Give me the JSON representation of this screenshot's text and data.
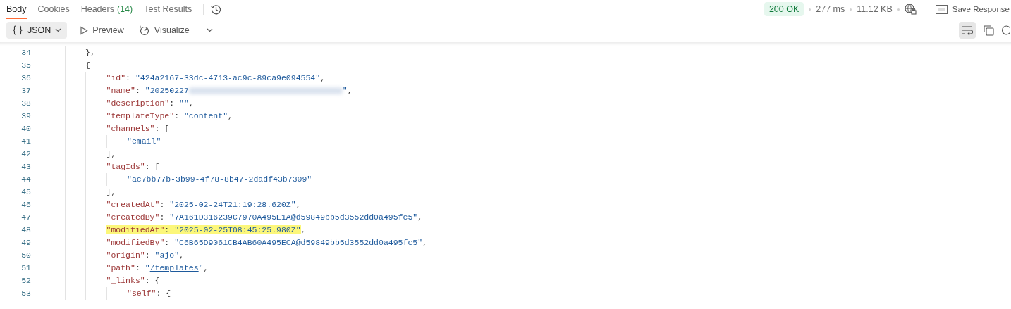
{
  "tabs": [
    {
      "label": "Body",
      "selected": true
    },
    {
      "label": "Cookies",
      "selected": false
    },
    {
      "label": "Headers",
      "count": "(14)",
      "selected": false
    },
    {
      "label": "Test Results",
      "selected": false
    }
  ],
  "status": {
    "code": "200 OK",
    "time": "277 ms",
    "size": "11.12 KB",
    "save": "Save Response"
  },
  "format": {
    "label": "JSON"
  },
  "views": [
    {
      "kind": "preview",
      "label": "Preview"
    },
    {
      "kind": "visualize",
      "label": "Visualize"
    }
  ],
  "wrap": {
    "selected": true
  },
  "code": [
    {
      "number": "34",
      "highlighted": false,
      "tokens": [
        {
          "kind": "punct",
          "text": "},"
        }
      ]
    },
    {
      "number": "35",
      "highlighted": false,
      "tokens": [
        {
          "kind": "punct",
          "text": "{"
        }
      ],
      "children": [
        {
          "number": "36",
          "highlighted": false,
          "tokens": [
            {
              "kind": "key",
              "text": "\"id\""
            },
            {
              "kind": "punct",
              "text": ": "
            },
            {
              "kind": "string",
              "text": "\"424a2167-33dc-4713-ac9c-89ca9e094554\""
            },
            {
              "kind": "punct",
              "text": ","
            }
          ]
        },
        {
          "number": "37",
          "highlighted": false,
          "tokens": [
            {
              "kind": "key",
              "text": "\"name\""
            },
            {
              "kind": "punct",
              "text": ": "
            },
            {
              "kind": "string",
              "text": "\"20250227"
            },
            {
              "kind": "redacted"
            },
            {
              "kind": "string",
              "text": "\""
            },
            {
              "kind": "punct",
              "text": ","
            }
          ]
        },
        {
          "number": "38",
          "highlighted": false,
          "tokens": [
            {
              "kind": "key",
              "text": "\"description\""
            },
            {
              "kind": "punct",
              "text": ": "
            },
            {
              "kind": "string",
              "text": "\"\""
            },
            {
              "kind": "punct",
              "text": ","
            }
          ]
        },
        {
          "number": "39",
          "highlighted": false,
          "tokens": [
            {
              "kind": "key",
              "text": "\"templateType\""
            },
            {
              "kind": "punct",
              "text": ": "
            },
            {
              "kind": "string",
              "text": "\"content\""
            },
            {
              "kind": "punct",
              "text": ","
            }
          ]
        },
        {
          "number": "40",
          "highlighted": false,
          "tokens": [
            {
              "kind": "key",
              "text": "\"channels\""
            },
            {
              "kind": "punct",
              "text": ": ["
            }
          ],
          "children": [
            {
              "number": "41",
              "highlighted": false,
              "tokens": [
                {
                  "kind": "string",
                  "text": "\"email\""
                }
              ]
            }
          ]
        },
        {
          "number": "42",
          "highlighted": false,
          "tokens": [
            {
              "kind": "punct",
              "text": "],"
            }
          ]
        },
        {
          "number": "43",
          "highlighted": false,
          "tokens": [
            {
              "kind": "key",
              "text": "\"tagIds\""
            },
            {
              "kind": "punct",
              "text": ": ["
            }
          ],
          "children": [
            {
              "number": "44",
              "highlighted": false,
              "tokens": [
                {
                  "kind": "string",
                  "text": "\"ac7bb77b-3b99-4f78-8b47-2dadf43b7309\""
                }
              ]
            }
          ]
        },
        {
          "number": "45",
          "highlighted": false,
          "tokens": [
            {
              "kind": "punct",
              "text": "],"
            }
          ]
        },
        {
          "number": "46",
          "highlighted": false,
          "tokens": [
            {
              "kind": "key",
              "text": "\"createdAt\""
            },
            {
              "kind": "punct",
              "text": ": "
            },
            {
              "kind": "string",
              "text": "\"2025-02-24T21:19:28.620Z\""
            },
            {
              "kind": "punct",
              "text": ","
            }
          ]
        },
        {
          "number": "47",
          "highlighted": false,
          "tokens": [
            {
              "kind": "key",
              "text": "\"createdBy\""
            },
            {
              "kind": "punct",
              "text": ": "
            },
            {
              "kind": "string",
              "text": "\"7A161D316239C7970A495E1A@d59849bb5d3552dd0a495fc5\""
            },
            {
              "kind": "punct",
              "text": ","
            }
          ]
        },
        {
          "number": "48",
          "highlighted": true,
          "tokens": [
            {
              "kind": "key",
              "text": "\"modifiedAt\""
            },
            {
              "kind": "punct",
              "text": ": "
            },
            {
              "kind": "string",
              "text": "\"2025-02-25T08:45:25.980Z\""
            },
            {
              "kind": "punct",
              "text": ","
            }
          ]
        },
        {
          "number": "49",
          "highlighted": false,
          "tokens": [
            {
              "kind": "key",
              "text": "\"modifiedBy\""
            },
            {
              "kind": "punct",
              "text": ": "
            },
            {
              "kind": "string",
              "text": "\"C6B65D9061CB4AB60A495ECA@d59849bb5d3552dd0a495fc5\""
            },
            {
              "kind": "punct",
              "text": ","
            }
          ]
        },
        {
          "number": "50",
          "highlighted": false,
          "tokens": [
            {
              "kind": "key",
              "text": "\"origin\""
            },
            {
              "kind": "punct",
              "text": ": "
            },
            {
              "kind": "string",
              "text": "\"ajo\""
            },
            {
              "kind": "punct",
              "text": ","
            }
          ]
        },
        {
          "number": "51",
          "highlighted": false,
          "tokens": [
            {
              "kind": "key",
              "text": "\"path\""
            },
            {
              "kind": "punct",
              "text": ": "
            },
            {
              "kind": "string",
              "text": "\""
            },
            {
              "kind": "link",
              "text": "/templates"
            },
            {
              "kind": "string",
              "text": "\""
            },
            {
              "kind": "punct",
              "text": ","
            }
          ]
        },
        {
          "number": "52",
          "highlighted": false,
          "tokens": [
            {
              "kind": "key",
              "text": "\"_links\""
            },
            {
              "kind": "punct",
              "text": ": {"
            }
          ],
          "children": [
            {
              "number": "53",
              "highlighted": false,
              "tokens": [
                {
                  "kind": "key",
                  "text": "\"self\""
                },
                {
                  "kind": "punct",
                  "text": ": {"
                }
              ]
            }
          ]
        }
      ]
    }
  ]
}
